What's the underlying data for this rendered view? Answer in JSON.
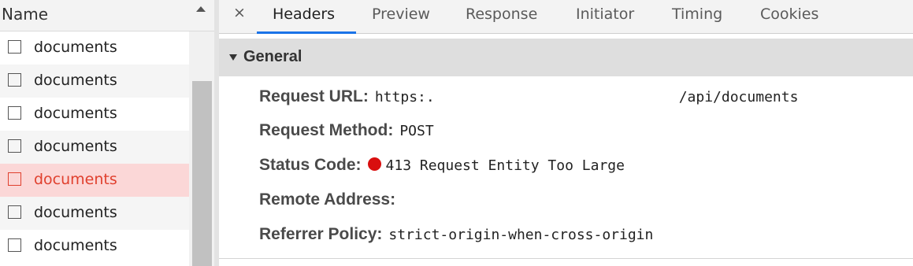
{
  "request_list": {
    "header": "Name",
    "rows": [
      {
        "label": "documents",
        "selected": false
      },
      {
        "label": "documents",
        "selected": false
      },
      {
        "label": "documents",
        "selected": false
      },
      {
        "label": "documents",
        "selected": false
      },
      {
        "label": "documents",
        "selected": true
      },
      {
        "label": "documents",
        "selected": false
      },
      {
        "label": "documents",
        "selected": false
      }
    ]
  },
  "tabs": {
    "close_glyph": "×",
    "items": [
      {
        "label": "Headers",
        "active": true
      },
      {
        "label": "Preview",
        "active": false
      },
      {
        "label": "Response",
        "active": false
      },
      {
        "label": "Initiator",
        "active": false
      },
      {
        "label": "Timing",
        "active": false
      },
      {
        "label": "Cookies",
        "active": false
      }
    ]
  },
  "general": {
    "title": "General",
    "request_url": {
      "label": "Request URL:",
      "prefix": "https:.",
      "suffix": "/api/documents"
    },
    "request_method": {
      "label": "Request Method:",
      "value": "POST"
    },
    "status_code": {
      "label": "Status Code:",
      "value": "413 Request Entity Too Large",
      "status_color": "#d90f0f"
    },
    "remote_address": {
      "label": "Remote Address:",
      "value": ""
    },
    "referrer_policy": {
      "label": "Referrer Policy:",
      "value": "strict-origin-when-cross-origin"
    }
  },
  "colors": {
    "accent": "#1a73e8",
    "selected_row_bg": "#fbd7d7",
    "selected_row_text": "#e0402e"
  }
}
